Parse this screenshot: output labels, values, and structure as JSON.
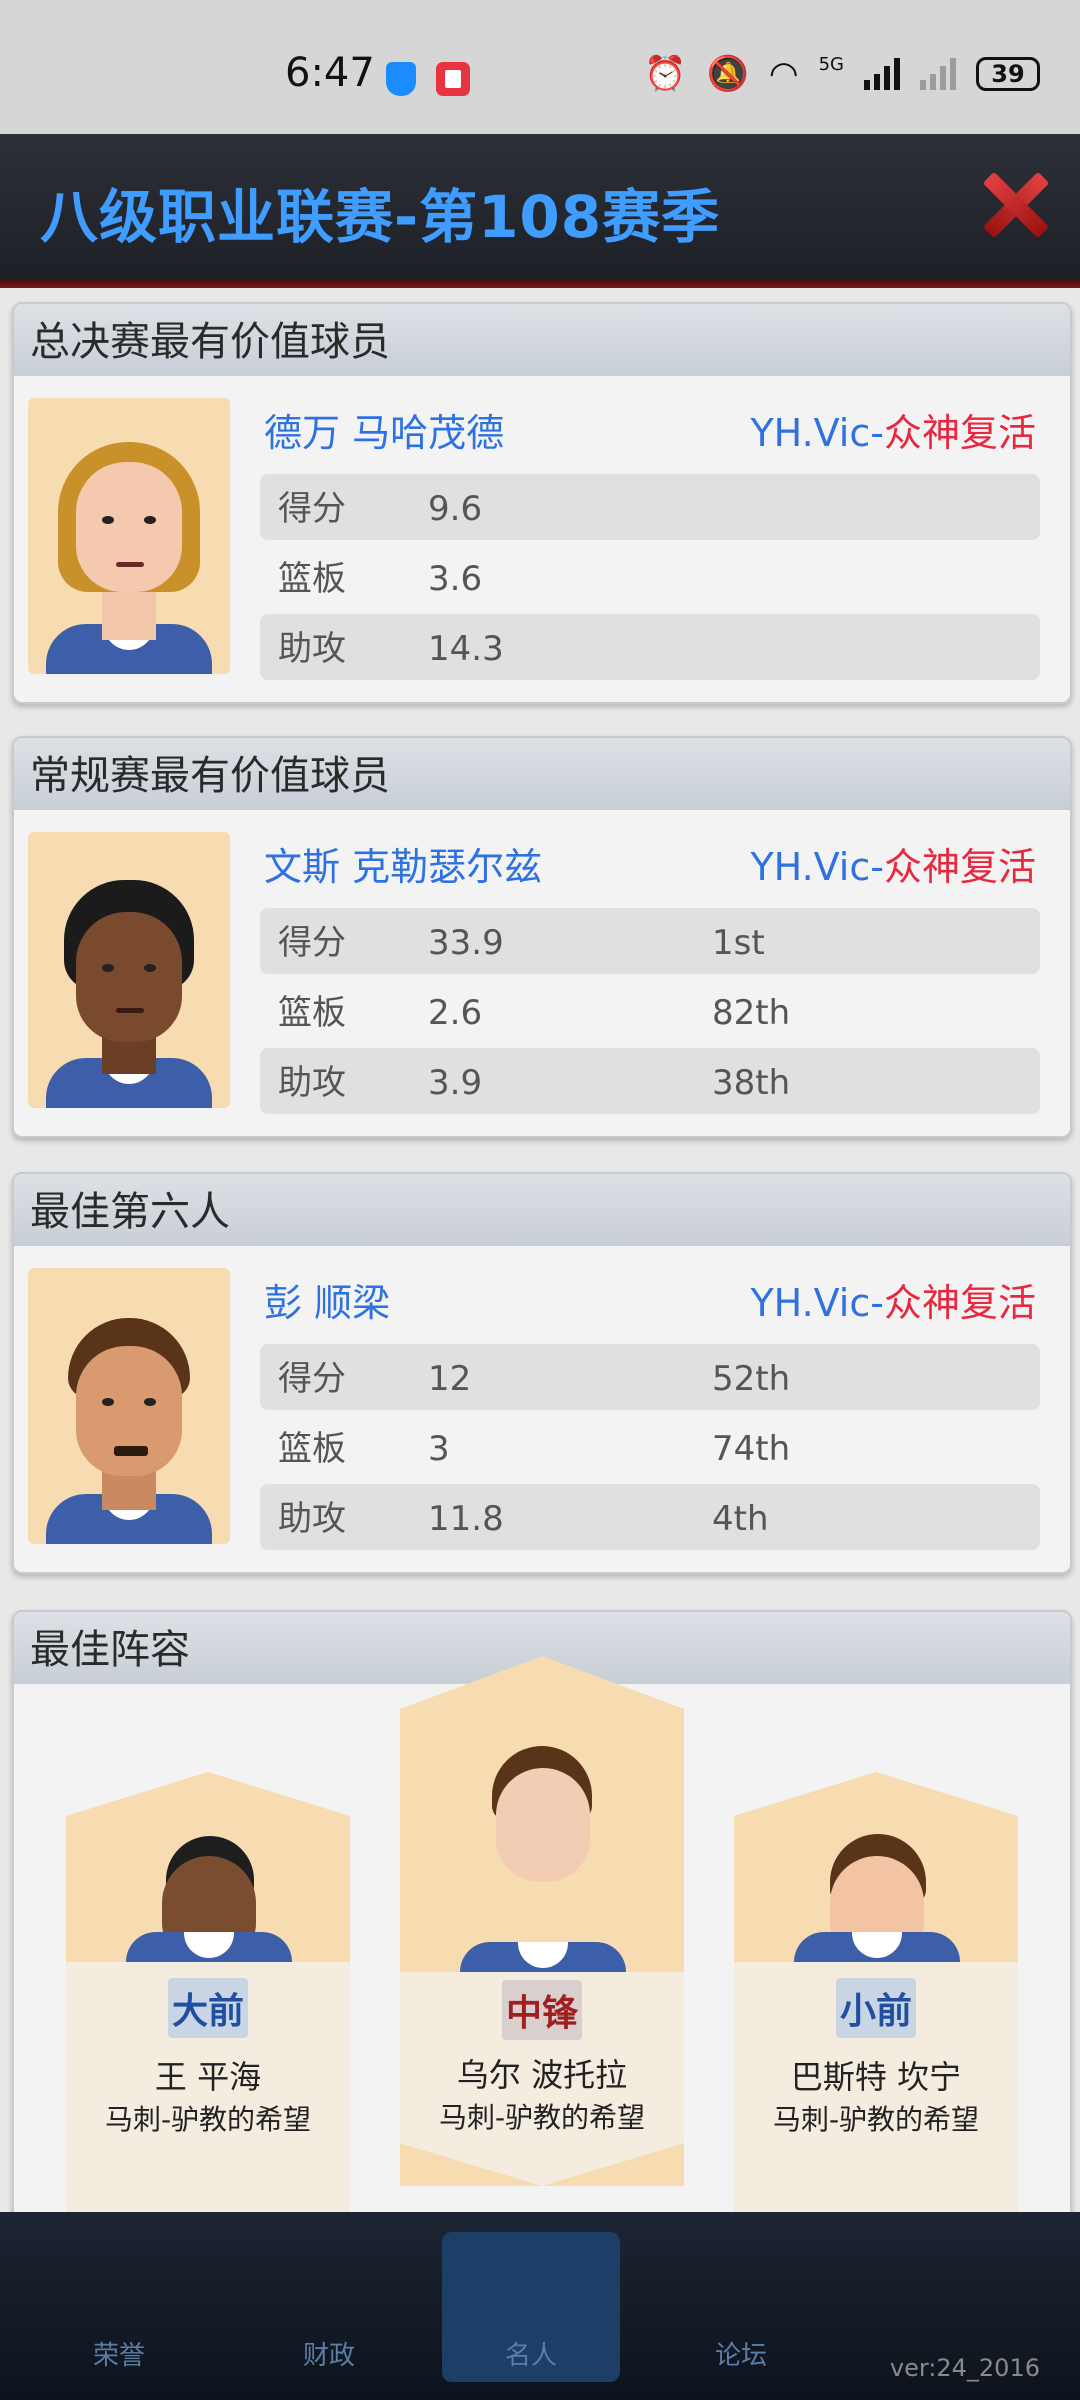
{
  "status_bar": {
    "time": "6:47",
    "network": "5G",
    "battery": "39"
  },
  "dialog": {
    "title": "八级职业联赛-第108赛季"
  },
  "awards": [
    {
      "heading": "总决赛最有价值球员",
      "player": "德万 马哈茂德",
      "team_prefix": "YH.Vic-",
      "team_suffix": "众神复活",
      "stats": [
        {
          "label": "得分",
          "value": "9.6",
          "rank": ""
        },
        {
          "label": "篮板",
          "value": "3.6",
          "rank": ""
        },
        {
          "label": "助攻",
          "value": "14.3",
          "rank": ""
        }
      ]
    },
    {
      "heading": "常规赛最有价值球员",
      "player": "文斯 克勒瑟尔兹",
      "team_prefix": "YH.Vic-",
      "team_suffix": "众神复活",
      "stats": [
        {
          "label": "得分",
          "value": "33.9",
          "rank": "1st"
        },
        {
          "label": "篮板",
          "value": "2.6",
          "rank": "82th"
        },
        {
          "label": "助攻",
          "value": "3.9",
          "rank": "38th"
        }
      ]
    },
    {
      "heading": "最佳第六人",
      "player": "彭 顺梁",
      "team_prefix": "YH.Vic-",
      "team_suffix": "众神复活",
      "stats": [
        {
          "label": "得分",
          "value": "12",
          "rank": "52th"
        },
        {
          "label": "篮板",
          "value": "3",
          "rank": "74th"
        },
        {
          "label": "助攻",
          "value": "11.8",
          "rank": "4th"
        }
      ]
    }
  ],
  "lineup": {
    "heading": "最佳阵容",
    "players": [
      {
        "position": "大前",
        "name": "王 平海",
        "team": "马刺-驴教的希望"
      },
      {
        "position": "中锋",
        "name": "乌尔 波托拉",
        "team": "马刺-驴教的希望"
      },
      {
        "position": "小前",
        "name": "巴斯特 坎宁",
        "team": "马刺-驴教的希望"
      }
    ]
  },
  "nav": {
    "tabs": [
      "荣誉",
      "财政",
      "名人",
      "论坛",
      ""
    ]
  },
  "version": "ver:24_2016",
  "colors": {
    "title_blue": "#3f9dff",
    "team_red": "#e8283f",
    "player_blue": "#2d72e0"
  }
}
